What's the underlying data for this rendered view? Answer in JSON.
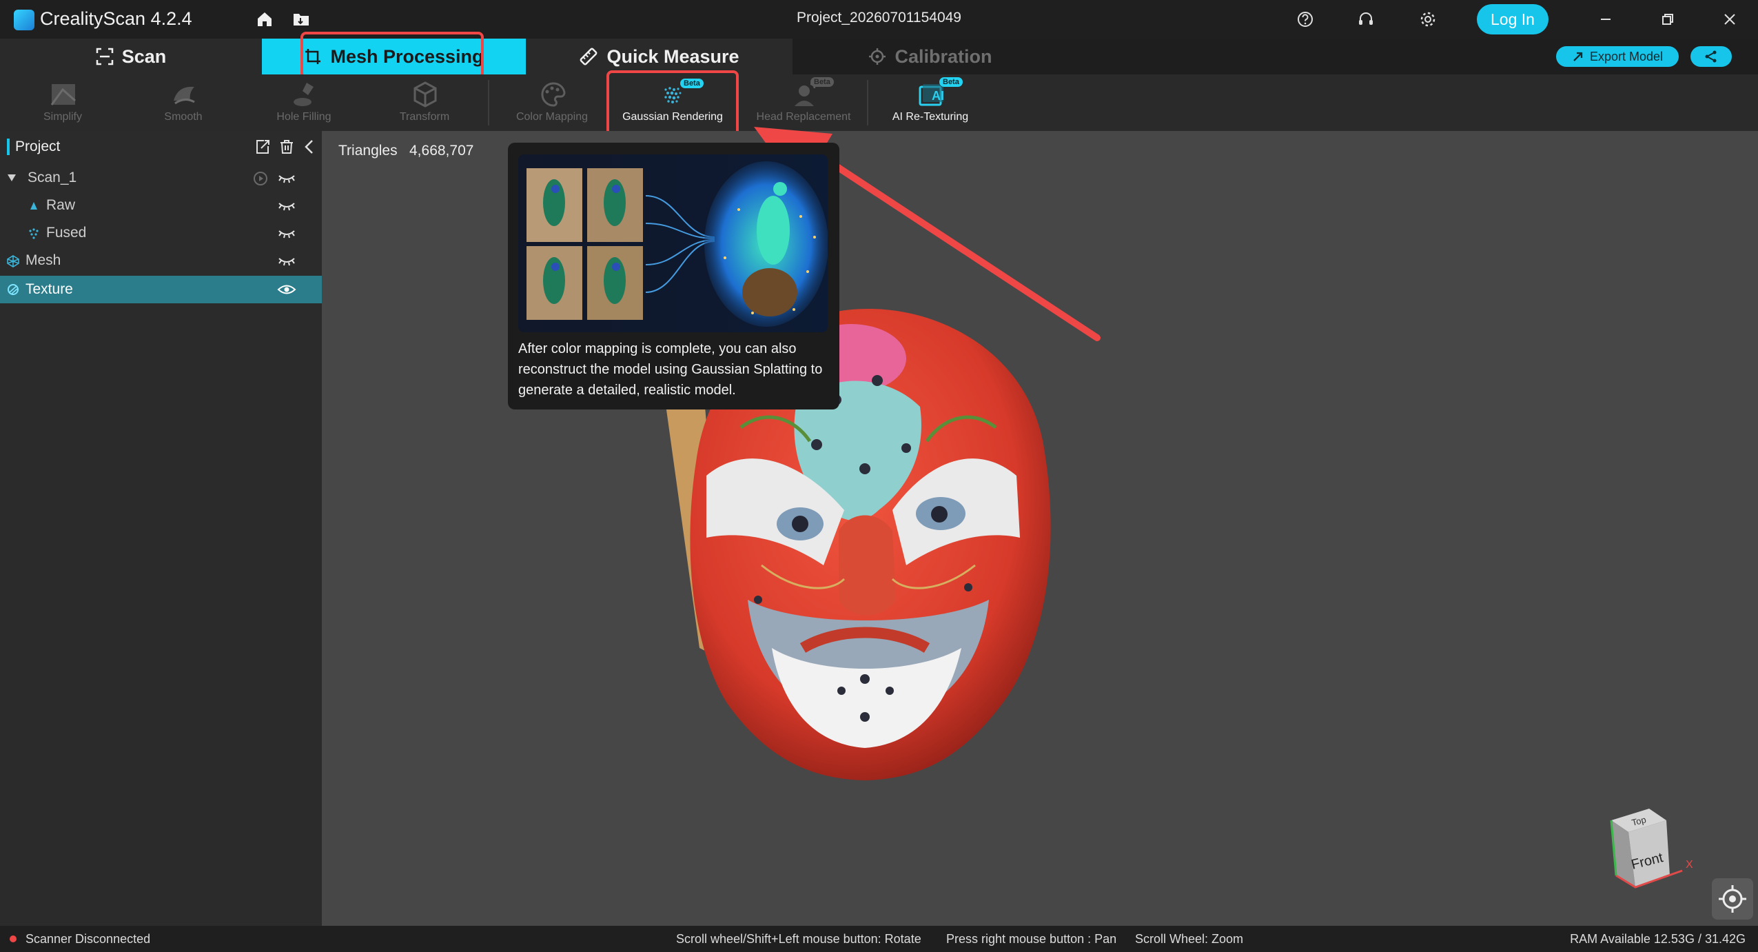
{
  "app": {
    "title": "CrealityScan 4.2.4",
    "project": "Project_20260701154049",
    "login_label": "Log In"
  },
  "tabs": {
    "scan": "Scan",
    "mesh": "Mesh Processing",
    "quick": "Quick Measure",
    "calibration": "Calibration"
  },
  "actions": {
    "export_model": "Export Model"
  },
  "tools": {
    "simplify": "Simplify",
    "smooth": "Smooth",
    "hole_filling": "Hole Filling",
    "transform": "Transform",
    "color_mapping": "Color Mapping",
    "gaussian": "Gaussian Rendering",
    "head_replacement": "Head Replacement",
    "ai_retexturing": "AI Re-Texturing",
    "beta_badge": "Beta",
    "ai_badge": "AI"
  },
  "panel": {
    "title": "Project",
    "tree": [
      "Scan_1",
      "Raw",
      "Fused",
      "Mesh",
      "Texture"
    ]
  },
  "viewport": {
    "triangles_label": "Triangles",
    "triangles_value": "4,668,707",
    "view_cube_top": "Top",
    "view_cube_front": "Front",
    "axis_x": "X"
  },
  "tooltip": {
    "text": "After color mapping is complete, you can also reconstruct the model using Gaussian Splatting to generate a detailed, realistic model."
  },
  "status": {
    "scanner": "Scanner Disconnected",
    "rotate_hint": "Scroll wheel/Shift+Left mouse button: Rotate",
    "pan_hint": "Press right mouse button : Pan",
    "zoom_hint": "Scroll Wheel: Zoom",
    "ram": "RAM Available 12.53G / 31.42G"
  },
  "colors": {
    "accent": "#17c5ea",
    "highlight": "#ef4646",
    "selected_row": "#2b7d8c"
  }
}
